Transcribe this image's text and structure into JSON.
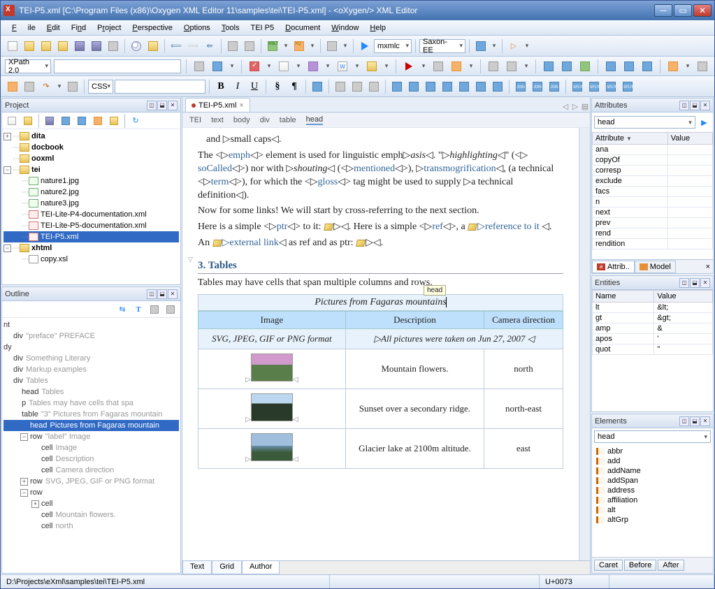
{
  "window": {
    "title": "TEI-P5.xml [C:\\Program Files (x86)\\Oxygen XML Editor 11\\samples\\tei\\TEI-P5.xml] - <oXygen/> XML Editor"
  },
  "menu": {
    "file": "File",
    "edit": "Edit",
    "find": "Find",
    "project": "Project",
    "perspective": "Perspective",
    "options": "Options",
    "tools": "Tools",
    "teip5": "TEI P5",
    "document": "Document",
    "window": "Window",
    "help": "Help"
  },
  "xpath": {
    "label": "XPath 2.0"
  },
  "toolbar2": {
    "run": "mxmlc",
    "engine": "Saxon-EE"
  },
  "styleRow": {
    "schemeLabel": "CSS"
  },
  "project": {
    "title": "Project",
    "tree": {
      "dita": "dita",
      "docbook": "docbook",
      "ooxml": "ooxml",
      "tei": "tei",
      "nature1": "nature1.jpg",
      "nature2": "nature2.jpg",
      "nature3": "nature3.jpg",
      "lite4": "TEI-Lite-P4-documentation.xml",
      "lite5": "TEI-Lite-P5-documentation.xml",
      "p5": "TEI-P5.xml",
      "xhtml": "xhtml",
      "copy": "copy.xsl"
    }
  },
  "outline": {
    "title": "Outline",
    "items": {
      "nt": "nt",
      "preface": "div",
      "prefaceTxt": "\"preface\" PREFACE",
      "dy": "dy",
      "some": "div",
      "someTxt": "Something Literary",
      "markup": "div",
      "markupTxt": "Markup examples",
      "tables": "div",
      "tablesTxt": "Tables",
      "headTables": "head",
      "headTablesTxt": "Tables",
      "pCells": "p",
      "pCellsTxt": "Tables may have cells that spa",
      "table": "table",
      "tableTxt": "\"3\" Pictures from Fagaras mountain",
      "headPic": "head",
      "headPicTxt": "Pictures from Fagaras mountain",
      "rowLabel": "row",
      "rowLabelTxt": "\"label\" Image",
      "cellImage": "cell",
      "cellImageTxt": "Image",
      "cellDesc": "cell",
      "cellDescTxt": "Description",
      "cellCam": "cell",
      "cellCamTxt": "Camera direction",
      "rowSvg": "row",
      "rowSvgTxt": "SVG, JPEG, GIF or PNG format",
      "row2": "row",
      "cell2": "cell",
      "cellMF": "cell",
      "cellMFTxt": "Mountain flowers.",
      "cellNorth": "cell",
      "cellNorthTxt": "north"
    }
  },
  "editor": {
    "tab": "TEI-P5.xml",
    "crumbs": {
      "tei": "TEI",
      "text": "text",
      "body": "body",
      "div": "div",
      "table": "table",
      "head": "head"
    },
    "content": {
      "smallcaps": "and ▷small caps◁.",
      "line1a": "The <▷",
      "emph": "emph",
      "line1b": "◁> element is used for linguistic emph▷",
      "asis": "asis",
      "line1c": "◁. \"▷",
      "hl": "highlighting",
      "line1d": "◁\" (<▷",
      "soCalled": "soCalled",
      "line2a": "◁>) nor with ▷",
      "shouting": "shouting",
      "line2b": "◁ (<▷",
      "mentioned": "mentioned",
      "line2c": "◁>), ▷",
      "transmog": "transmogrification",
      "line2d": "◁, (a",
      "line3a": "technical <▷",
      "term": "term",
      "line3b": "◁>), for which the <▷",
      "gloss": "gloss",
      "line3c": "◁> tag might be used to supply ▷a",
      "line3d": "technical definition◁).",
      "links": "Now for some links! We will start by cross-referring to the next section.",
      "simple1a": "Here is a simple <▷",
      "ptr": "ptr",
      "simple1b": "◁> to it: ",
      "simple1c": "▷◁. Here is a simple <▷",
      "ref": "ref",
      "simple1d": "◁>, a ",
      "refit": "▷reference to it",
      "close": "◁.",
      "ext1": "An ",
      "extlink": "▷external link",
      "ext2": "◁ as ref and as ptr: ",
      "ext3": "▷◁.",
      "h3": "3. Tables",
      "tablesTxt": "Tables may have cells that span multiple columns and rows.",
      "caption": "Pictures from Fagaras mountains",
      "headTip": "head",
      "th1": "Image",
      "th2": "Description",
      "th3": "Camera direction",
      "r0c1": "SVG, JPEG, GIF or PNG format",
      "r0c2": "▷All pictures were taken on Jun 27, 2007 ◁",
      "r1c2": "Mountain flowers.",
      "r1c3": "north",
      "r2c2": "Sunset over a secondary ridge.",
      "r2c3": "north-east",
      "r3c2": "Glacier lake at 2100m altitude.",
      "r3c3": "east"
    },
    "modes": {
      "text": "Text",
      "grid": "Grid",
      "author": "Author"
    }
  },
  "attrs": {
    "title": "Attributes",
    "elem": "head",
    "cols": {
      "attr": "Attribute",
      "val": "Value"
    },
    "rows": [
      "ana",
      "copyOf",
      "corresp",
      "exclude",
      "facs",
      "n",
      "next",
      "prev",
      "rend",
      "rendition"
    ],
    "tabs": {
      "attrib": "Attrib..",
      "model": "Model"
    }
  },
  "entities": {
    "title": "Entities",
    "cols": {
      "name": "Name",
      "val": "Value"
    },
    "rows": [
      {
        "n": "lt",
        "v": "<"
      },
      {
        "n": "gt",
        "v": ">"
      },
      {
        "n": "amp",
        "v": "&"
      },
      {
        "n": "apos",
        "v": "'"
      },
      {
        "n": "quot",
        "v": "\""
      }
    ]
  },
  "elements": {
    "title": "Elements",
    "elem": "head",
    "list": [
      "abbr",
      "add",
      "addName",
      "addSpan",
      "address",
      "affiliation",
      "alt",
      "altGrp"
    ],
    "btns": {
      "caret": "Caret",
      "before": "Before",
      "after": "After"
    }
  },
  "status": {
    "path": "D:\\Projects\\eXml\\samples\\tei\\TEI-P5.xml",
    "code": "U+0073"
  }
}
